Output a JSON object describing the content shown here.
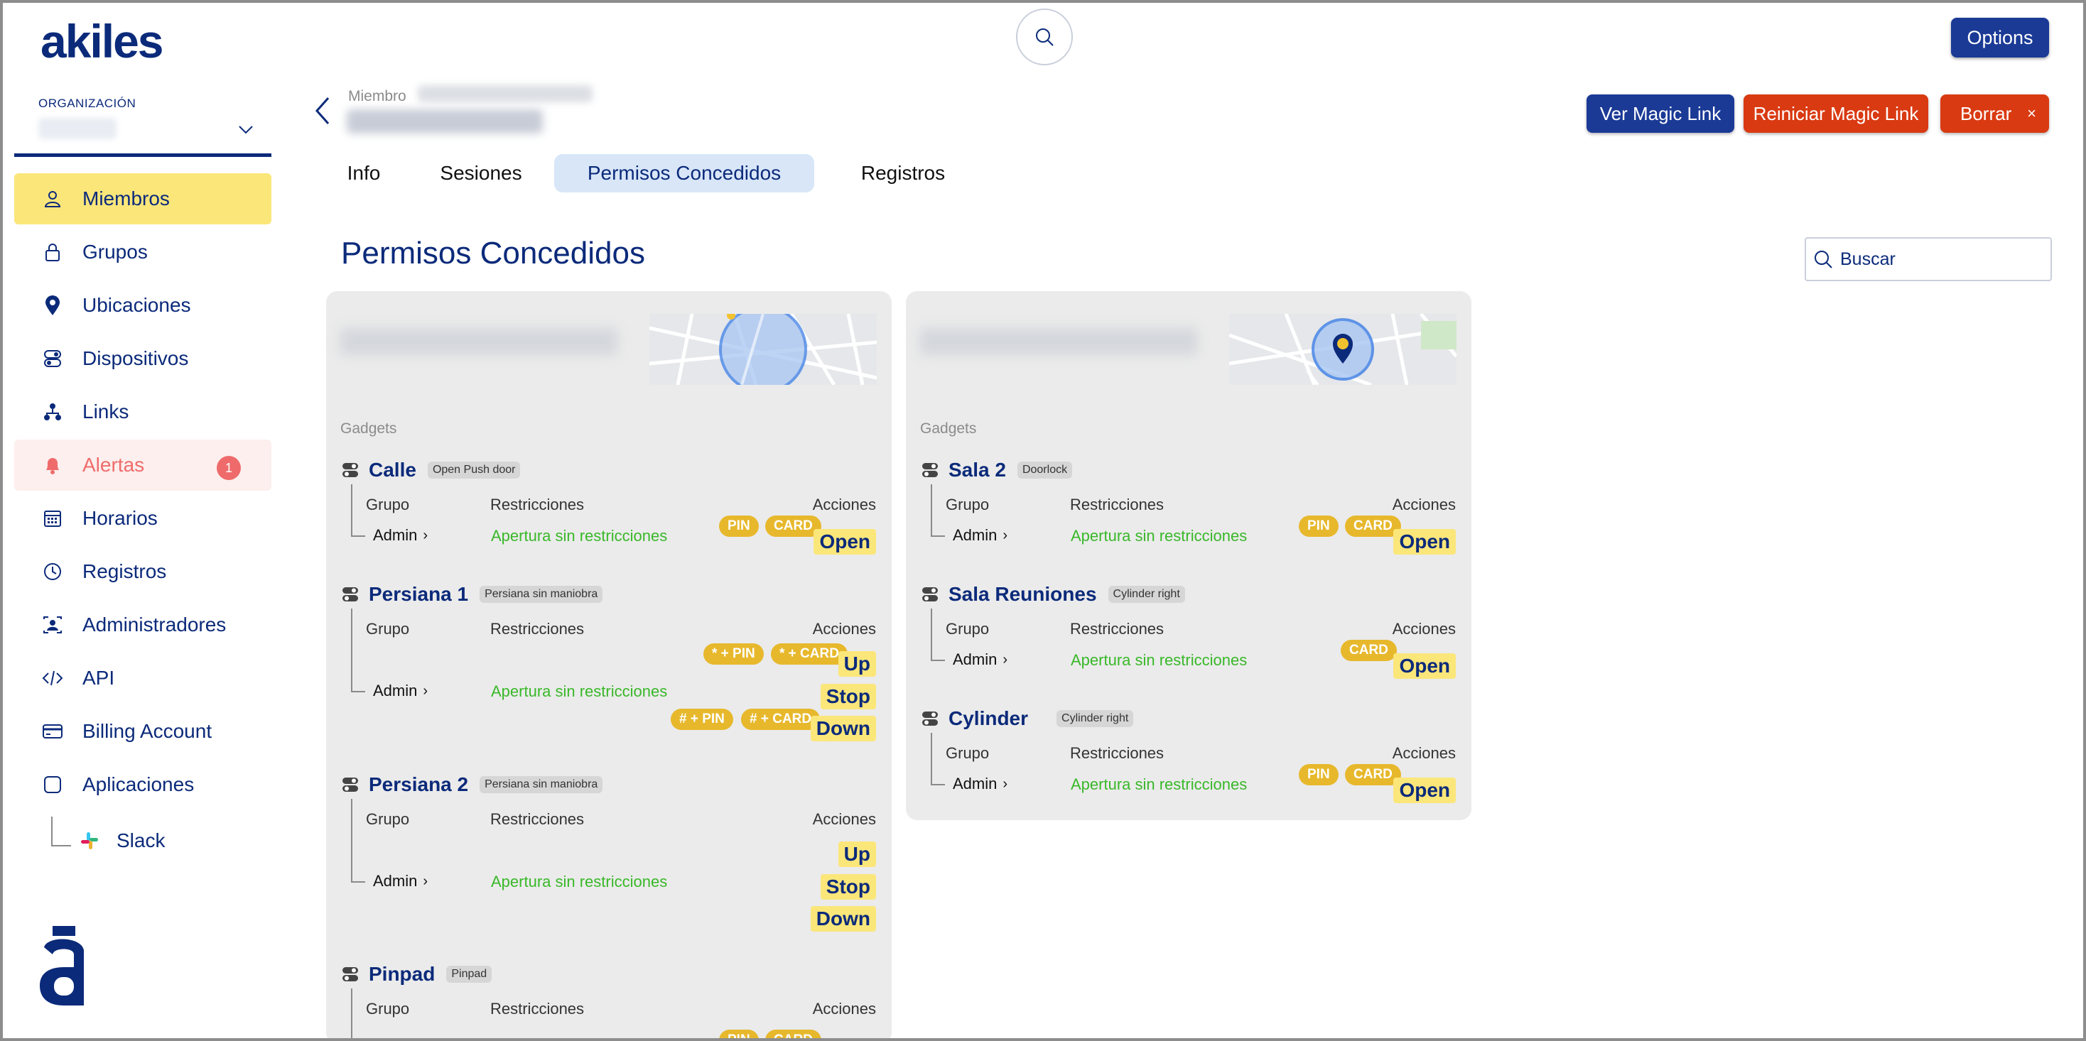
{
  "app": {
    "brand": "akiles",
    "options_label": "Options"
  },
  "sidebar": {
    "org_label": "ORGANIZACIÓN",
    "items": [
      {
        "label": "Miembros",
        "icon": "user-icon",
        "active": true
      },
      {
        "label": "Grupos",
        "icon": "lock-icon"
      },
      {
        "label": "Ubicaciones",
        "icon": "location-pin-icon"
      },
      {
        "label": "Dispositivos",
        "icon": "toggle-device-icon"
      },
      {
        "label": "Links",
        "icon": "people-link-icon"
      },
      {
        "label": "Alertas",
        "icon": "bell-icon",
        "badge": "1"
      },
      {
        "label": "Horarios",
        "icon": "calendar-icon"
      },
      {
        "label": "Registros",
        "icon": "clock-icon"
      },
      {
        "label": "Administradores",
        "icon": "admin-badge-icon"
      },
      {
        "label": "API",
        "icon": "code-icon"
      },
      {
        "label": "Billing Account",
        "icon": "credit-card-icon"
      },
      {
        "label": "Aplicaciones",
        "icon": "app-square-icon"
      }
    ],
    "sub_item": {
      "label": "Slack",
      "icon": "slack-icon"
    }
  },
  "member": {
    "label": "Miembro"
  },
  "header_buttons": {
    "ver_magic_link": "Ver Magic Link",
    "reiniciar_magic_link": "Reiniciar Magic Link",
    "borrar": "Borrar",
    "borrar_close": "×"
  },
  "tabs": [
    {
      "label": "Info"
    },
    {
      "label": "Sesiones"
    },
    {
      "label": "Permisos Concedidos",
      "active": true
    },
    {
      "label": "Registros"
    }
  ],
  "section": {
    "title": "Permisos Concedidos",
    "search_placeholder": "Buscar"
  },
  "columns": {
    "grupo": "Grupo",
    "restricciones": "Restricciones",
    "acciones": "Acciones"
  },
  "gadgets_label": "Gadgets",
  "cards": [
    {
      "gadgets": [
        {
          "name": "Calle",
          "tag": "Open Push door",
          "grupo": "Admin",
          "restriccion": "Apertura sin restricciones",
          "pills": [
            "PIN",
            "CARD"
          ],
          "actions": [
            "Open"
          ]
        },
        {
          "name": "Persiana 1",
          "tag": "Persiana sin maniobra",
          "grupo": "Admin",
          "restriccion": "Apertura sin restricciones",
          "pills_top": [
            "* + PIN",
            "* + CARD"
          ],
          "pills_bottom": [
            "# + PIN",
            "# + CARD"
          ],
          "actions": [
            "Up",
            "Stop",
            "Down"
          ]
        },
        {
          "name": "Persiana 2",
          "tag": "Persiana sin maniobra",
          "grupo": "Admin",
          "restriccion": "Apertura sin restricciones",
          "actions": [
            "Up",
            "Stop",
            "Down"
          ]
        },
        {
          "name": "Pinpad",
          "tag": "Pinpad",
          "pills": [
            "PIN",
            "CARD"
          ]
        }
      ]
    },
    {
      "gadgets": [
        {
          "name": "Sala 2",
          "tag": "Doorlock",
          "grupo": "Admin",
          "restriccion": "Apertura sin restricciones",
          "pills": [
            "PIN",
            "CARD"
          ],
          "actions": [
            "Open"
          ]
        },
        {
          "name": "Sala Reuniones",
          "tag": "Cylinder right",
          "grupo": "Admin",
          "restriccion": "Apertura sin restricciones",
          "pills": [
            "CARD"
          ],
          "actions": [
            "Open"
          ]
        },
        {
          "name": "Cylinder",
          "tag": "Cylinder right",
          "grupo": "Admin",
          "restriccion": "Apertura sin restricciones",
          "pills": [
            "PIN",
            "CARD"
          ],
          "actions": [
            "Open"
          ]
        }
      ]
    }
  ],
  "colors": {
    "primary": "#1b3a96",
    "danger": "#d93a12",
    "highlight": "#fbe67a",
    "pill": "#e7b82c",
    "alert": "#ef6b6b",
    "success_text": "#39b829"
  }
}
